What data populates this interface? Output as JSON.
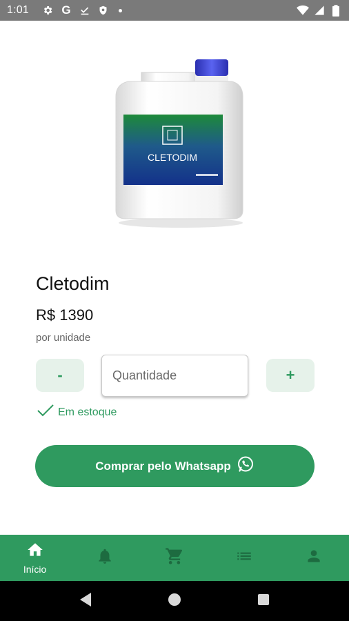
{
  "status_bar": {
    "time": "1:01"
  },
  "product": {
    "label_text": "CLETODIM",
    "name": "Cletodim",
    "price": "R$ 1390",
    "unit": "por unidade"
  },
  "quantity": {
    "minus_label": "-",
    "plus_label": "+",
    "placeholder": "Quantidade"
  },
  "stock": {
    "label": "Em estoque"
  },
  "buy_button": {
    "label": "Comprar pelo Whatsapp"
  },
  "bottom_nav": {
    "items": [
      {
        "label": "Início",
        "icon": "home-icon",
        "active": true
      },
      {
        "label": "",
        "icon": "bell-icon"
      },
      {
        "label": "",
        "icon": "cart-icon"
      },
      {
        "label": "",
        "icon": "list-icon"
      },
      {
        "label": "",
        "icon": "person-icon"
      }
    ]
  },
  "colors": {
    "primary": "#2f9a5f",
    "primary_light": "#e6f2ea",
    "status_bar": "#7a7a7a"
  }
}
